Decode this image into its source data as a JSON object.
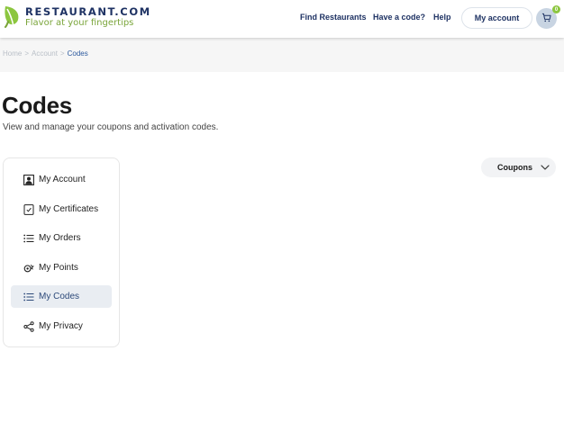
{
  "header": {
    "brand": "RESTAURANT.COM",
    "tagline": "Flavor at your fingertips",
    "nav": {
      "find_restaurants": "Find Restaurants",
      "have_a_code": "Have a code?",
      "help": "Help"
    },
    "account_button": "My account",
    "cart_count": "0"
  },
  "breadcrumb": {
    "items": [
      "Home",
      "Account",
      "Codes"
    ],
    "separator": ">"
  },
  "page": {
    "title": "Codes",
    "subtitle": "View and manage your coupons and activation codes."
  },
  "sidebar": {
    "items": [
      {
        "label": "My Account",
        "icon": "user-square-icon"
      },
      {
        "label": "My Certificates",
        "icon": "certificate-icon"
      },
      {
        "label": "My Orders",
        "icon": "list-icon"
      },
      {
        "label": "My Points",
        "icon": "points-icon"
      },
      {
        "label": "My Codes",
        "icon": "list-icon",
        "active": true
      },
      {
        "label": "My Privacy",
        "icon": "share-icon"
      }
    ]
  },
  "filter": {
    "selected": "Coupons"
  },
  "colors": {
    "navy": "#1e3263",
    "green": "#8cc63f",
    "active_bg": "#e9edf2"
  }
}
